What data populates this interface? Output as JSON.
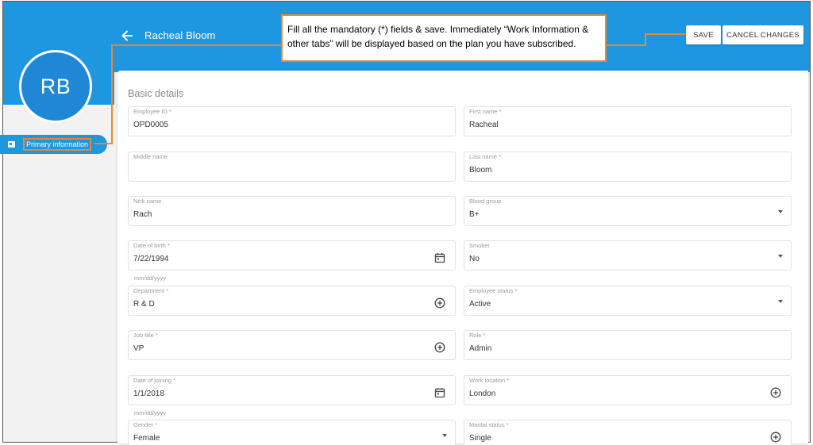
{
  "header": {
    "title": "Racheal Bloom",
    "save_label": "SAVE",
    "cancel_label": "CANCEL CHANGES",
    "accent_color": "#1e96e0"
  },
  "avatar": {
    "initials": "RB"
  },
  "sidebar": {
    "items": [
      {
        "label": "Primary information",
        "icon": "id-card-icon"
      }
    ]
  },
  "callout": {
    "text": "Fill all the mandatory (*) fields & save. Immediately “Work Information & other tabs” will be displayed based on the plan you have subscribed.",
    "border_color": "#e8892f"
  },
  "section": {
    "title": "Basic details"
  },
  "fields": {
    "employee_id": {
      "label": "Employee ID *",
      "value": "OPD0005"
    },
    "first_name": {
      "label": "First name *",
      "value": "Racheal"
    },
    "middle_name": {
      "label": "Middle name",
      "value": ""
    },
    "last_name": {
      "label": "Last name *",
      "value": "Bloom"
    },
    "nick_name": {
      "label": "Nick name",
      "value": "Rach"
    },
    "blood_group": {
      "label": "Blood group",
      "value": "B+"
    },
    "dob": {
      "label": "Date of birth *",
      "value": "7/22/1994",
      "hint": "mm/dd/yyyy"
    },
    "smoker": {
      "label": "Smoker",
      "value": "No"
    },
    "department": {
      "label": "Department *",
      "value": "R & D"
    },
    "employee_status": {
      "label": "Employee status *",
      "value": "Active"
    },
    "job_title": {
      "label": "Job title *",
      "value": "VP"
    },
    "role": {
      "label": "Role *",
      "value": "Admin"
    },
    "doj": {
      "label": "Date of joining *",
      "value": "1/1/2018",
      "hint": "mm/dd/yyyy"
    },
    "work_location": {
      "label": "Work location *",
      "value": "London"
    },
    "gender": {
      "label": "Gender *",
      "value": "Female"
    },
    "marital_status": {
      "label": "Marital status *",
      "value": "Single"
    }
  }
}
